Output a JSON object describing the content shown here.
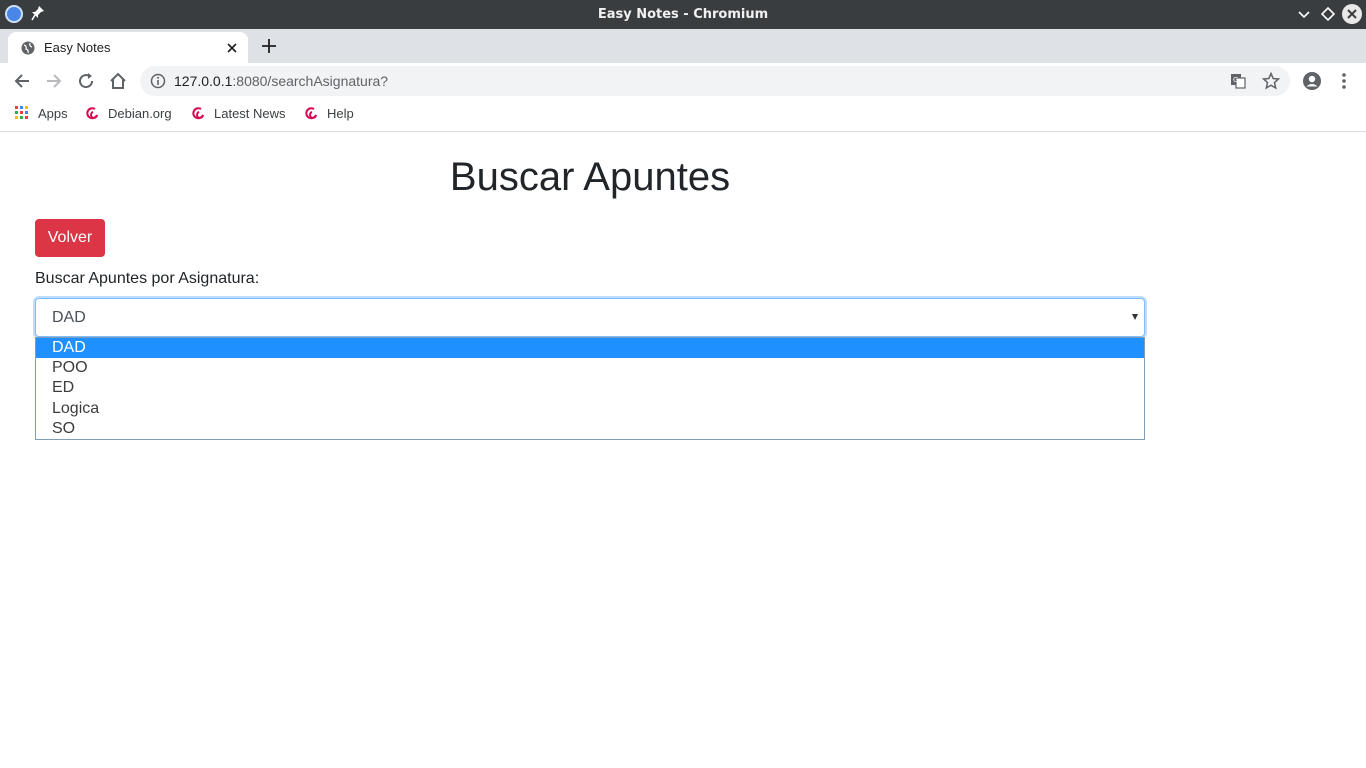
{
  "window": {
    "title": "Easy Notes - Chromium"
  },
  "tab": {
    "title": "Easy Notes"
  },
  "address_bar": {
    "host": "127.0.0.1",
    "rest": ":8080/searchAsignatura?"
  },
  "bookmarks": [
    {
      "label": "Apps",
      "icon": "apps-grid-icon"
    },
    {
      "label": "Debian.org",
      "icon": "debian-icon"
    },
    {
      "label": "Latest News",
      "icon": "debian-icon"
    },
    {
      "label": "Help",
      "icon": "debian-icon"
    }
  ],
  "page": {
    "title": "Buscar Apuntes",
    "back_button": "Volver",
    "search_label": "Buscar Apuntes por Asignatura:",
    "select": {
      "value": "DAD",
      "options": [
        "DAD",
        "POO",
        "ED",
        "Logica",
        "SO"
      ],
      "highlighted": "DAD"
    }
  },
  "colors": {
    "back_button": "#dc3545",
    "option_highlight": "#1e90ff",
    "titlebar": "#3a3d40",
    "tabstrip": "#dee1e6"
  }
}
